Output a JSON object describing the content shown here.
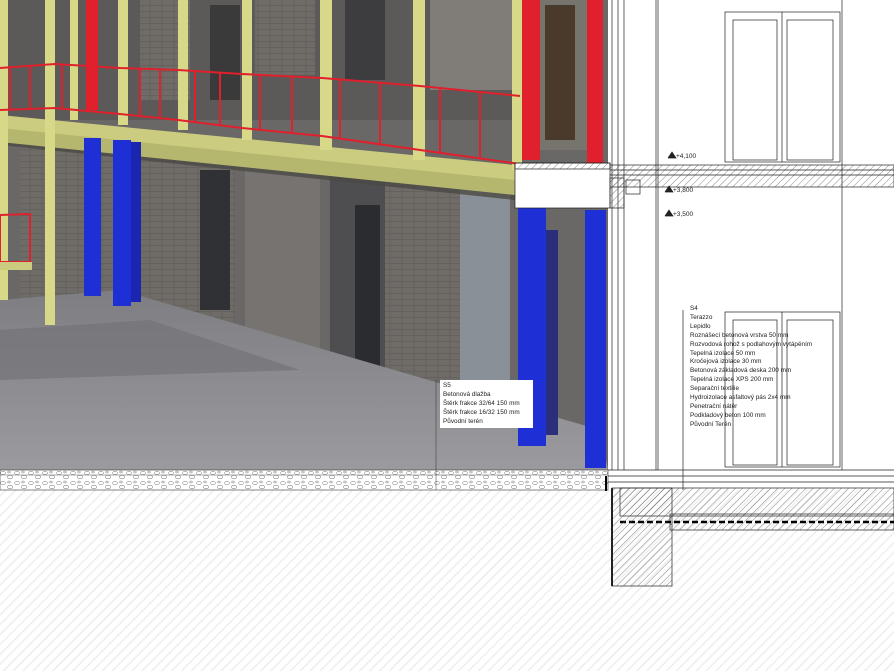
{
  "levels": {
    "l1": "+4,100",
    "l2": "+3,800",
    "l3": "+3,500"
  },
  "s5": {
    "code": "S5",
    "layers": [
      "Betonová dlažba",
      "Štěrk frakce 32/64 150 mm",
      "Štěrk frakce 16/32 150 mm",
      "Původní terén"
    ]
  },
  "s4": {
    "code": "S4",
    "layers": [
      "Terazzo",
      "Lepidlo",
      "Roznášecí betonová vrstva 50 mm",
      "Rozvodová rohož s podlahovým vytápěním",
      "Tepelná izolace 50 mm",
      "Kročejová izolace 30 mm",
      "Betonová základová deska 200 mm",
      "Tepelná izolace XPS 200 mm",
      "Separační textilie",
      "Hydroizolace asfaltový pás 2x4 mm",
      "Penetrační nátěr",
      "Podkladový beton 100 mm",
      "Původní Terén"
    ]
  },
  "colors": {
    "columns_blue": "#1f2fd6",
    "columns_red": "#e0202c",
    "frame_yellow": "#d8d889",
    "brick": "#6d6a66",
    "paving": "#8a8a8e"
  }
}
